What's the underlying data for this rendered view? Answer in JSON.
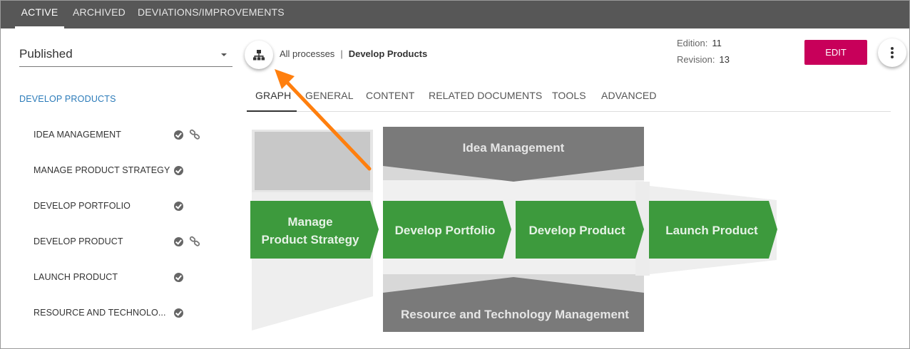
{
  "top_tabs": [
    {
      "label": "ACTIVE"
    },
    {
      "label": "ARCHIVED"
    },
    {
      "label": "DEVIATIONS/IMPROVEMENTS"
    }
  ],
  "left": {
    "status_select": "Published",
    "parent": "DEVELOP PRODUCTS",
    "items": [
      {
        "label": "IDEA MANAGEMENT"
      },
      {
        "label": "MANAGE PRODUCT STRATEGY"
      },
      {
        "label": "DEVELOP PORTFOLIO"
      },
      {
        "label": "DEVELOP PRODUCT"
      },
      {
        "label": "LAUNCH PRODUCT"
      },
      {
        "label": "RESOURCE AND TECHNOLO..."
      }
    ]
  },
  "breadcrumb": {
    "root": "All processes",
    "separator": "|",
    "current": "Develop Products"
  },
  "meta": {
    "edition_label": "Edition:",
    "edition": "11",
    "revision_label": "Revision:",
    "revision": "13"
  },
  "actions": {
    "edit": "EDIT"
  },
  "content_tabs": [
    {
      "label": "GRAPH"
    },
    {
      "label": "GENERAL"
    },
    {
      "label": "CONTENT"
    },
    {
      "label": "RELATED DOCUMENTS"
    },
    {
      "label": "TOOLS"
    },
    {
      "label": "ADVANCED"
    }
  ],
  "graph": {
    "top": "Idea Management",
    "bottom": "Resource and Technology Management",
    "steps": [
      {
        "line1": "Manage",
        "line2": "Product Strategy"
      },
      {
        "line1": "Develop Portfolio"
      },
      {
        "line1": "Develop Product"
      },
      {
        "line1": "Launch Product"
      }
    ]
  },
  "colors": {
    "green": "#3d9a3d",
    "gray": "#7a7a7a",
    "accent": "#c8005a",
    "link": "#2b7bb9",
    "arrow": "#ff7f0e"
  }
}
